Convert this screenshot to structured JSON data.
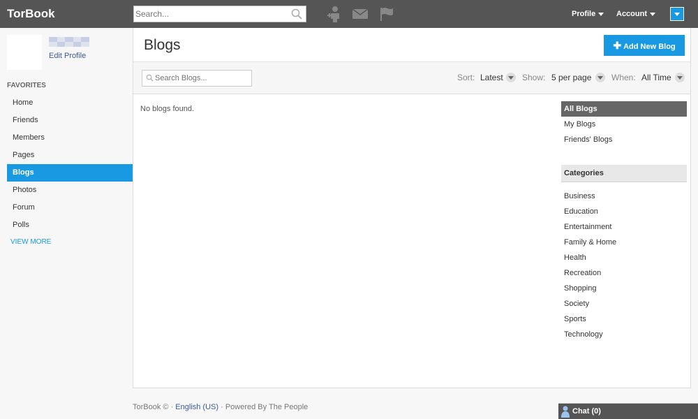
{
  "header": {
    "brand": "TorBook",
    "search_placeholder": "Search...",
    "profile_label": "Profile",
    "account_label": "Account"
  },
  "user": {
    "edit_profile": "Edit Profile"
  },
  "sidebar": {
    "favorites_heading": "FAVORITES",
    "items": [
      {
        "label": "Home"
      },
      {
        "label": "Friends"
      },
      {
        "label": "Members"
      },
      {
        "label": "Pages"
      },
      {
        "label": "Blogs",
        "active": true
      },
      {
        "label": "Photos"
      },
      {
        "label": "Forum"
      },
      {
        "label": "Polls"
      }
    ],
    "view_more": "VIEW MORE"
  },
  "main": {
    "title": "Blogs",
    "add_button": "Add New Blog",
    "search_placeholder": "Search Blogs...",
    "sort_label": "Sort:",
    "sort_value": "Latest",
    "show_label": "Show:",
    "show_value": "5 per page",
    "when_label": "When:",
    "when_value": "All Time",
    "empty_message": "No blogs found."
  },
  "filters": {
    "all_blogs": "All Blogs",
    "my_blogs": "My Blogs",
    "friends_blogs": "Friends' Blogs"
  },
  "categories": {
    "heading": "Categories",
    "items": [
      "Business",
      "Education",
      "Entertainment",
      "Family & Home",
      "Health",
      "Recreation",
      "Shopping",
      "Society",
      "Sports",
      "Technology"
    ]
  },
  "footer": {
    "brand": "TorBook ©",
    "sep1": " · ",
    "language": "English (US)",
    "sep2": " · ",
    "powered": "Powered By The People"
  },
  "chat": {
    "label": "Chat (0)"
  },
  "colors": {
    "accent": "#1899e2",
    "topbar": "#555555"
  }
}
